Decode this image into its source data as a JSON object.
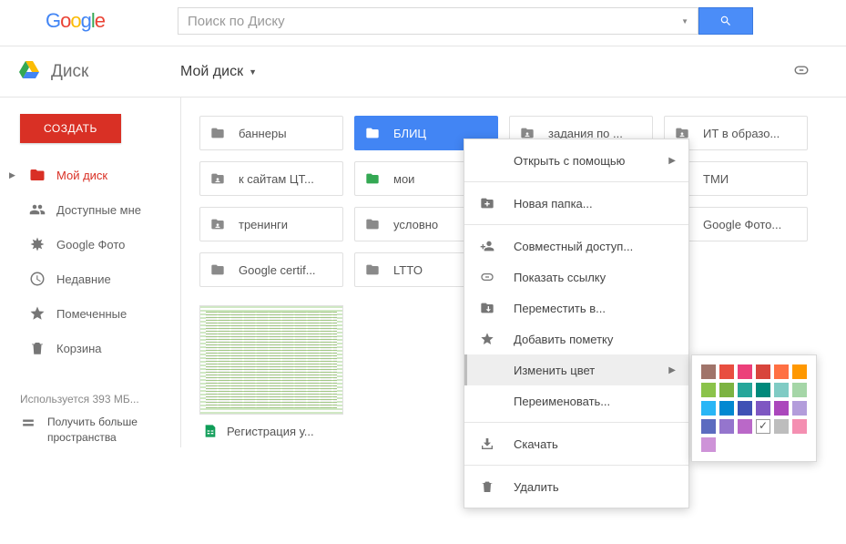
{
  "header": {
    "logo_letters": [
      "G",
      "o",
      "o",
      "g",
      "l",
      "e"
    ],
    "search_placeholder": "Поиск по Диску"
  },
  "subheader": {
    "drive_label": "Диск",
    "breadcrumb": "Мой диск"
  },
  "sidebar": {
    "create_label": "СОЗДАТЬ",
    "items": [
      {
        "label": "Мой диск",
        "active": true
      },
      {
        "label": "Доступные мне"
      },
      {
        "label": "Google Фото"
      },
      {
        "label": "Недавние"
      },
      {
        "label": "Помеченные"
      },
      {
        "label": "Корзина"
      }
    ],
    "storage_text": "Используется 393 МБ...",
    "upgrade_text": "Получить больше пространства"
  },
  "folders": {
    "row1": [
      {
        "label": "баннеры"
      },
      {
        "label": "БЛИЦ",
        "selected": true
      },
      {
        "label": "задания по ...",
        "shared": true
      },
      {
        "label": "ИТ в образо...",
        "shared": true
      }
    ],
    "row2": [
      {
        "label": "к сайтам ЦТ...",
        "shared": true
      },
      {
        "label": "мои",
        "green": true
      },
      {
        "label": "",
        "hidden_by_menu": true
      },
      {
        "label": "ТМИ",
        "shared": true
      }
    ],
    "row3": [
      {
        "label": "тренинги",
        "shared": true
      },
      {
        "label": "условно"
      },
      {
        "label": "",
        "hidden_by_menu": true
      },
      {
        "label": "Google Фото...",
        "shared": true
      }
    ],
    "row4": [
      {
        "label": "Google certif..."
      },
      {
        "label": "LTTO"
      }
    ]
  },
  "file": {
    "label": "Регистрация у..."
  },
  "context_menu": {
    "items": [
      {
        "label": "Открыть с помощью",
        "icon": "none",
        "submenu": true
      },
      {
        "sep": true
      },
      {
        "label": "Новая папка...",
        "icon": "new-folder"
      },
      {
        "sep": true
      },
      {
        "label": "Совместный доступ...",
        "icon": "share"
      },
      {
        "label": "Показать ссылку",
        "icon": "link"
      },
      {
        "label": "Переместить в...",
        "icon": "move"
      },
      {
        "label": "Добавить пометку",
        "icon": "star"
      },
      {
        "label": "Изменить цвет",
        "icon": "none",
        "submenu": true,
        "highlight": true
      },
      {
        "label": "Переименовать...",
        "icon": "none"
      },
      {
        "sep": true
      },
      {
        "label": "Скачать",
        "icon": "download"
      },
      {
        "sep": true
      },
      {
        "label": "Удалить",
        "icon": "trash"
      }
    ]
  },
  "color_menu": {
    "colors": [
      "#a0746a",
      "#e84e40",
      "#ec407a",
      "#d8453c",
      "#ff7043",
      "#ff9800",
      "#8bc34a",
      "#7cb342",
      "#26a69a",
      "#00897b",
      "#80cbc4",
      "#a5d6a7",
      "#29b6f6",
      "#0288d1",
      "#3f51b5",
      "#7e57c2",
      "#ab47bc",
      "#b39ddb",
      "#5c6bc0",
      "#9575cd",
      "#ba68c8",
      "#checked",
      "#bdbdbd",
      "",
      "#f48fb1",
      "#ce93d8",
      "",
      "",
      "",
      ""
    ]
  }
}
